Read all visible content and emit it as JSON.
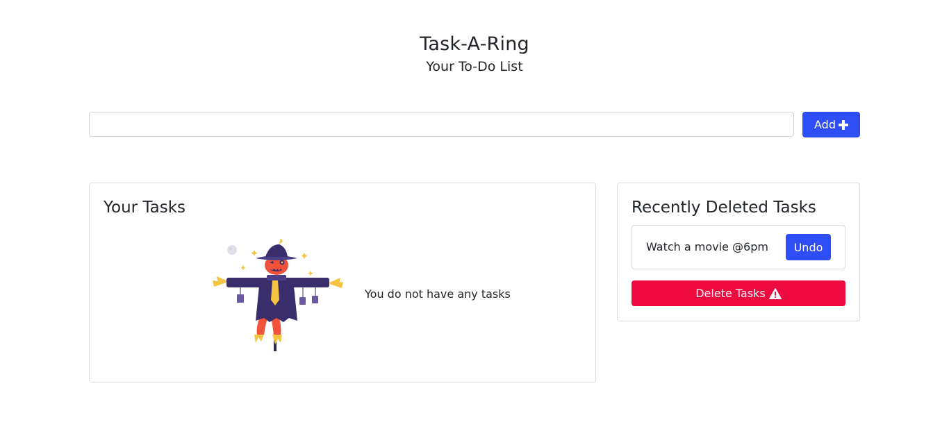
{
  "header": {
    "title": "Task-A-Ring",
    "subtitle": "Your To-Do List"
  },
  "add_form": {
    "input_value": "",
    "input_placeholder": "",
    "add_label": "Add",
    "add_icon": "plus-icon"
  },
  "tasks_panel": {
    "title": "Your Tasks",
    "illustration": "scarecrow-illustration",
    "empty_message": "You do not have any tasks"
  },
  "deleted_panel": {
    "title": "Recently Deleted Tasks",
    "items": [
      {
        "text": "Watch a movie @6pm",
        "undo_label": "Undo"
      }
    ],
    "delete_label": "Delete Tasks",
    "delete_icon": "warning-triangle-icon"
  },
  "colors": {
    "primary": "#2f4df5",
    "danger": "#ee0a3e",
    "border": "#dcdcdc",
    "text": "#212529"
  }
}
